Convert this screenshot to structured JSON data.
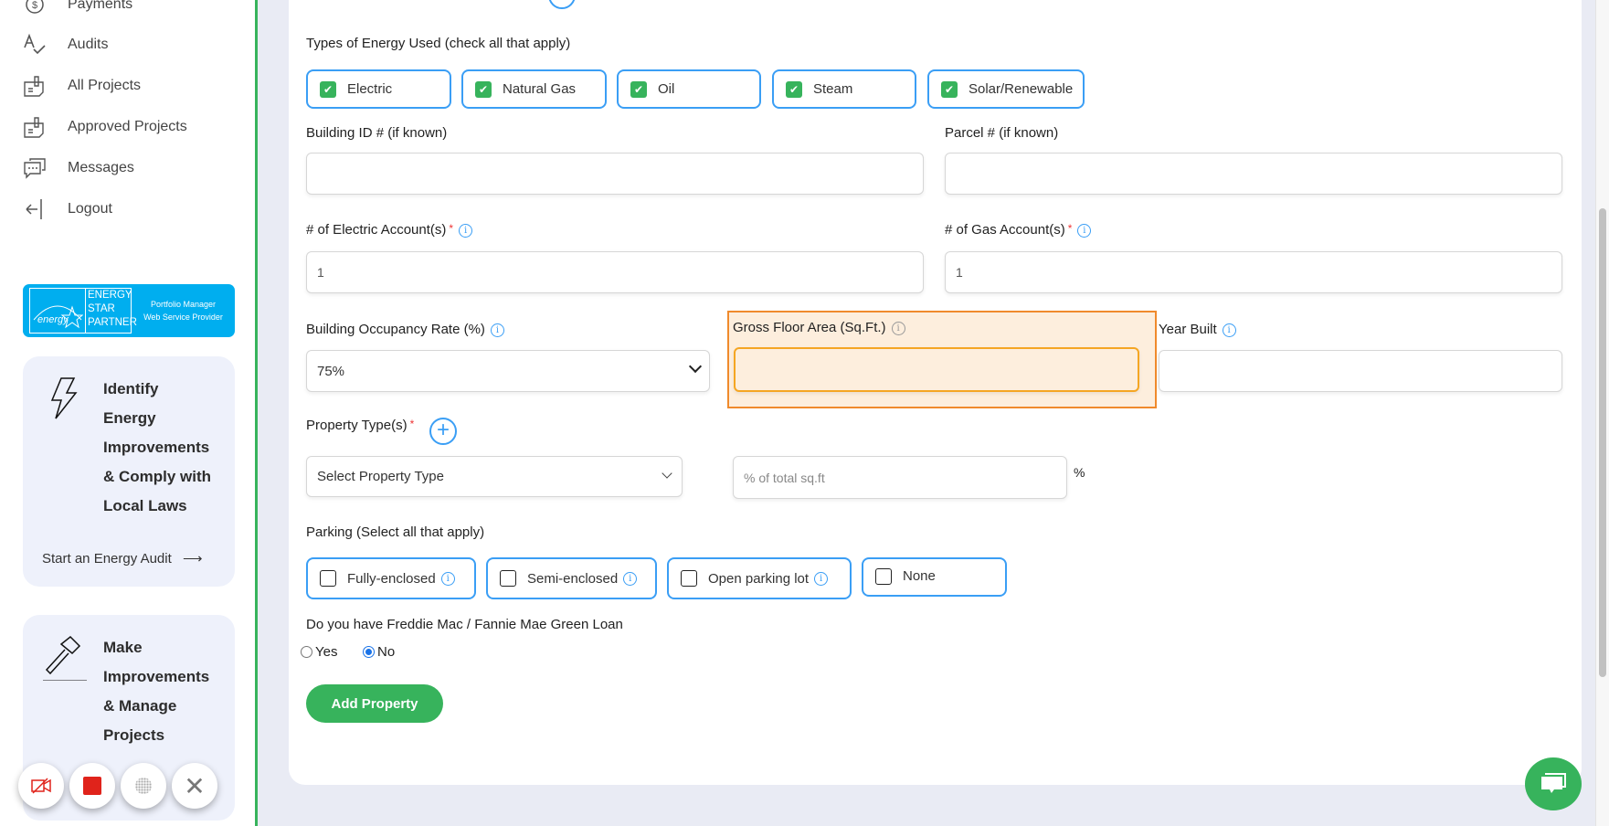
{
  "sidebar": {
    "items": [
      {
        "label": "Payments",
        "icon": "payments-icon"
      },
      {
        "label": "Audits",
        "icon": "audits-icon"
      },
      {
        "label": "All Projects",
        "icon": "projects-icon"
      },
      {
        "label": "Approved Projects",
        "icon": "projects-icon"
      },
      {
        "label": "Messages",
        "icon": "messages-icon"
      },
      {
        "label": "Logout",
        "icon": "logout-icon"
      }
    ],
    "logo": {
      "brand": "ENERGY STAR PARTNER",
      "line1": "Portfolio Manager",
      "line2": "Web Service Provider",
      "color": "#00aeef"
    },
    "cards": [
      {
        "lines": [
          "Identify",
          "Energy",
          "Improvements",
          "& Comply with",
          "Local Laws"
        ],
        "link": "Start an Energy Audit"
      },
      {
        "lines": [
          "Make",
          "Improvements",
          "& Manage",
          "Projects"
        ]
      }
    ]
  },
  "form": {
    "energy_label": "Types of Energy Used (check all that apply)",
    "energy_types": [
      {
        "label": "Electric",
        "checked": true
      },
      {
        "label": "Natural Gas",
        "checked": true
      },
      {
        "label": "Oil",
        "checked": true
      },
      {
        "label": "Steam",
        "checked": true
      },
      {
        "label": "Solar/Renewable",
        "checked": true
      }
    ],
    "building_id_label": "Building ID # (if known)",
    "parcel_label": "Parcel # (if known)",
    "electric_accounts_label": "# of Electric Account(s)",
    "electric_accounts_value": "1",
    "gas_accounts_label": "# of Gas Account(s)",
    "gas_accounts_value": "1",
    "occupancy_label": "Building Occupancy Rate (%)",
    "occupancy_value": "75%",
    "gross_floor_label": "Gross Floor Area (Sq.Ft.)",
    "year_built_label": "Year Built",
    "property_type_label": "Property Type(s)",
    "property_type_placeholder": "Select Property Type",
    "percent_placeholder": "% of total sq.ft",
    "percent_unit": "%",
    "parking_label": "Parking (Select all that apply)",
    "parking": [
      {
        "label": "Fully-enclosed",
        "checked": false
      },
      {
        "label": "Semi-enclosed",
        "checked": false
      },
      {
        "label": "Open parking lot",
        "checked": false
      },
      {
        "label": "None",
        "checked": false
      }
    ],
    "loan_label": "Do you have Freddie Mac / Fannie Mae Green Loan",
    "loan_options": [
      {
        "label": "Yes",
        "selected": false
      },
      {
        "label": "No",
        "selected": true
      }
    ],
    "submit_label": "Add Property",
    "required_mark": "*",
    "accent": "#37b35c",
    "highlight": "#f08a2c"
  }
}
